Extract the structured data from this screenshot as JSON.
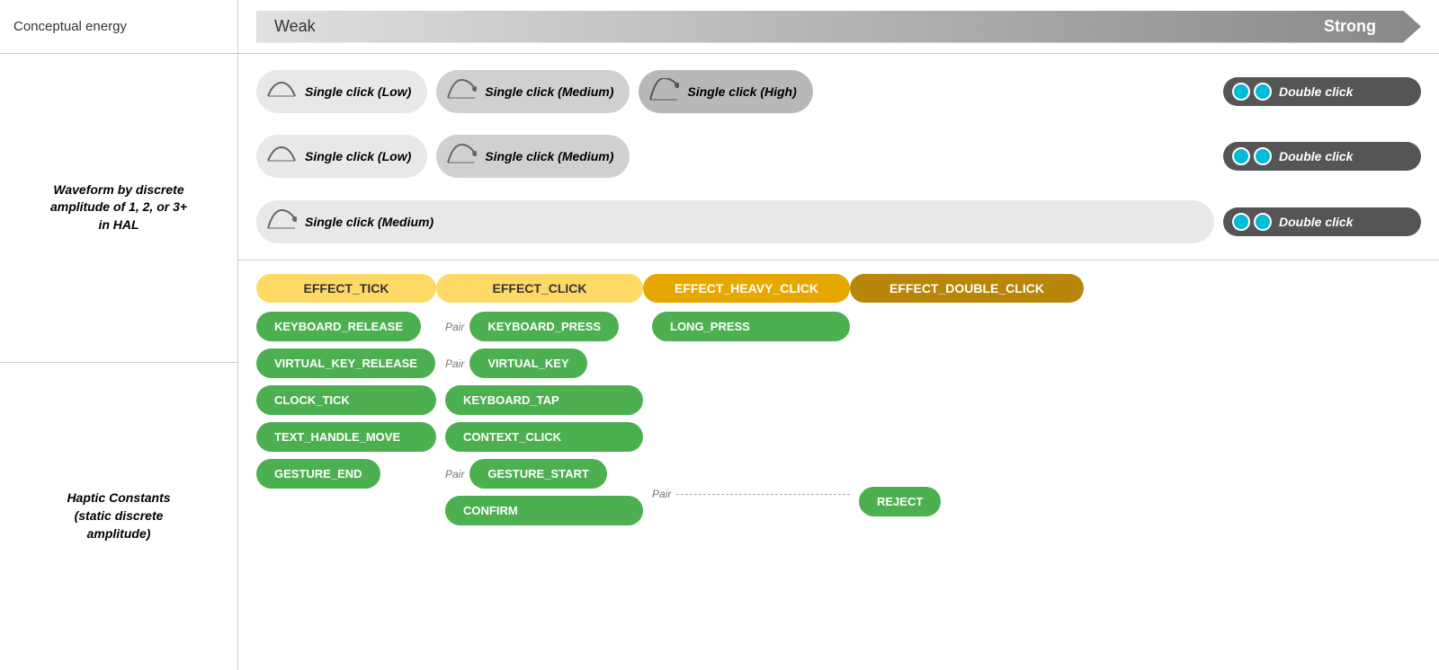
{
  "leftCol": {
    "top": "Conceptual energy",
    "waveformLabel": "Waveform by discrete\namplitude of 1, 2, or 3+\nin HAL",
    "hapticLabel": "Haptic Constants\n(static discrete\namplitude)"
  },
  "energyBar": {
    "weak": "Weak",
    "strong": "Strong"
  },
  "waveformRows": [
    {
      "pills": [
        {
          "icon": "low",
          "label": "Single click (Low)"
        },
        {
          "icon": "medium",
          "label": "Single click (Medium)"
        },
        {
          "icon": "high",
          "label": "Single click (High)"
        }
      ],
      "doubleClick": "Double click"
    },
    {
      "pills": [
        {
          "icon": "low",
          "label": "Single click (Low)"
        },
        {
          "icon": "medium",
          "label": "Single click (Medium)"
        }
      ],
      "doubleClick": "Double click"
    },
    {
      "pills": [
        {
          "icon": "medium",
          "label": "Single click (Medium)"
        }
      ],
      "doubleClick": "Double click"
    }
  ],
  "effects": [
    {
      "label": "EFFECT_TICK",
      "type": "tick"
    },
    {
      "label": "EFFECT_CLICK",
      "type": "click"
    },
    {
      "label": "EFFECT_HEAVY_CLICK",
      "type": "heavy"
    },
    {
      "label": "EFFECT_DOUBLE_CLICK",
      "type": "double"
    }
  ],
  "hapticCols": {
    "col1": {
      "buttons": [
        "KEYBOARD_RELEASE",
        "VIRTUAL_KEY_RELEASE",
        "CLOCK_TICK",
        "TEXT_HANDLE_MOVE",
        "GESTURE_END"
      ],
      "pairs": [
        {
          "from": "KEYBOARD_RELEASE",
          "label": "Pair"
        },
        {
          "from": "VIRTUAL_KEY_RELEASE",
          "label": "Pair"
        },
        {
          "from": "GESTURE_END",
          "label": "Pair"
        }
      ]
    },
    "col2": {
      "buttons": [
        "KEYBOARD_PRESS",
        "VIRTUAL_KEY",
        "KEYBOARD_TAP",
        "CONTEXT_CLICK",
        "GESTURE_START",
        "CONFIRM"
      ],
      "pairs": []
    },
    "col3": {
      "buttons": [
        "LONG_PRESS"
      ],
      "pairs": [
        {
          "from": "CONFIRM",
          "label": "Pair"
        }
      ]
    },
    "col4": {
      "buttons": [
        "REJECT"
      ],
      "pairs": []
    }
  }
}
